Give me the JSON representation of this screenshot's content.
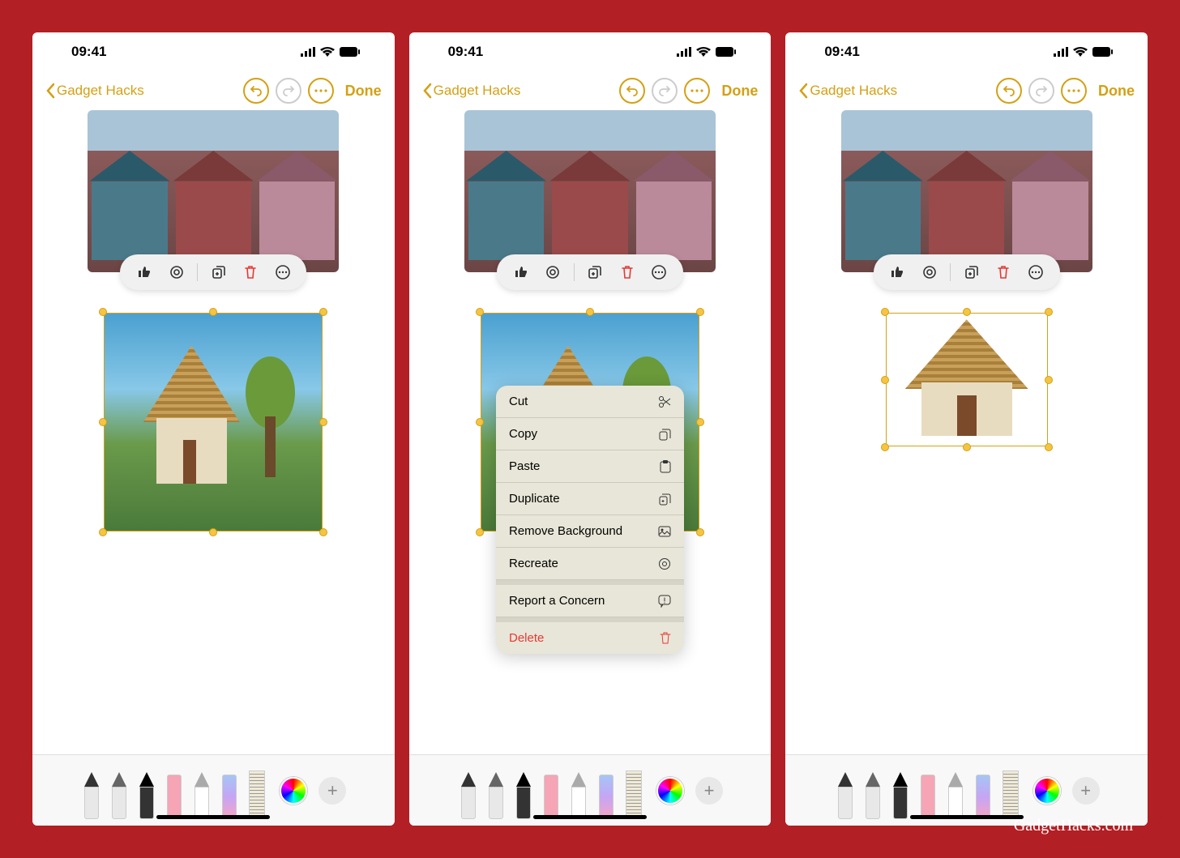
{
  "status_bar": {
    "time": "09:41"
  },
  "nav": {
    "back_label": "Gadget Hacks",
    "done_label": "Done"
  },
  "ai_toolbar": {
    "feedback": "thumbs-feedback",
    "regen": "regenerate",
    "copy": "copy",
    "delete": "delete",
    "more": "more"
  },
  "context_menu": {
    "cut": "Cut",
    "copy": "Copy",
    "paste": "Paste",
    "duplicate": "Duplicate",
    "remove_bg": "Remove Background",
    "recreate": "Recreate",
    "report": "Report a Concern",
    "delete": "Delete"
  },
  "images": {
    "street_houses_alt": "AI-generated row of suburban houses",
    "thatched_hut_alt": "AI-generated thatched-roof hut with tree",
    "thatched_hut_nbg_alt": "Thatched hut with background removed"
  },
  "attribution": "GadgetHacks.com"
}
